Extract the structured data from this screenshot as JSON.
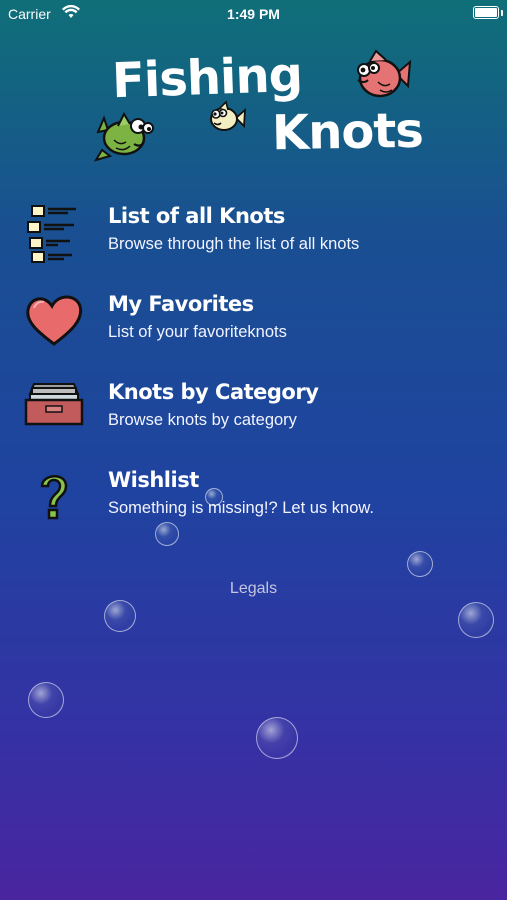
{
  "status_bar": {
    "carrier": "Carrier",
    "time": "1:49 PM"
  },
  "logo": {
    "line1": "Fishing",
    "line2": "Knots"
  },
  "menu": [
    {
      "title": "List of all Knots",
      "subtitle": "Browse through the list of all knots",
      "icon": "list-icon"
    },
    {
      "title": "My Favorites",
      "subtitle": "List of your favoriteknots",
      "icon": "heart-icon"
    },
    {
      "title": "Knots by Category",
      "subtitle": "Browse knots by category",
      "icon": "card-box-icon"
    },
    {
      "title": "Wishlist",
      "subtitle": "Something is missing!? Let us know.",
      "icon": "question-mark-icon"
    }
  ],
  "footer": {
    "legals": "Legals"
  },
  "colors": {
    "heart": "#e86a6a",
    "fish_green": "#7cb342",
    "fish_red": "#e57373",
    "fish_yellow": "#f4efc2",
    "question": "#8bc34a"
  }
}
